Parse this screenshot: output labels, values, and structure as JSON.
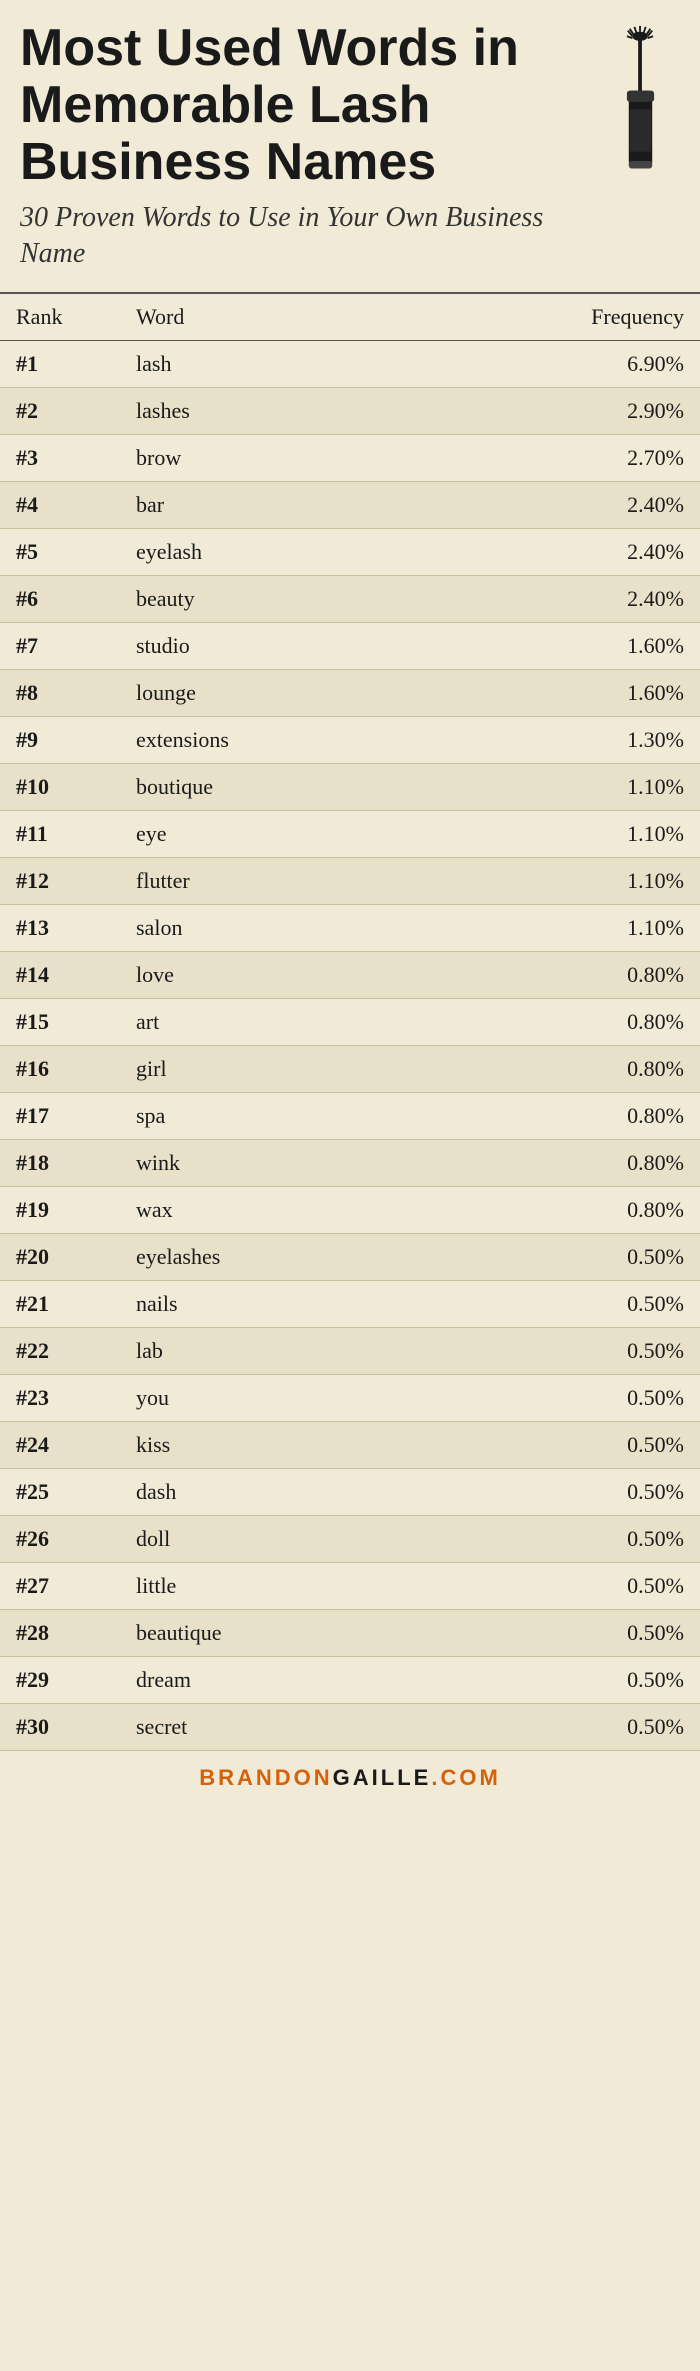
{
  "header": {
    "main_title": "Most Used Words in Memorable Lash Business Names",
    "subtitle": "30 Proven Words to Use in Your Own Business Name"
  },
  "table": {
    "columns": [
      "Rank",
      "Word",
      "Frequency"
    ],
    "rows": [
      {
        "rank": "#1",
        "word": "lash",
        "frequency": "6.90%"
      },
      {
        "rank": "#2",
        "word": "lashes",
        "frequency": "2.90%"
      },
      {
        "rank": "#3",
        "word": "brow",
        "frequency": "2.70%"
      },
      {
        "rank": "#4",
        "word": "bar",
        "frequency": "2.40%"
      },
      {
        "rank": "#5",
        "word": "eyelash",
        "frequency": "2.40%"
      },
      {
        "rank": "#6",
        "word": "beauty",
        "frequency": "2.40%"
      },
      {
        "rank": "#7",
        "word": "studio",
        "frequency": "1.60%"
      },
      {
        "rank": "#8",
        "word": "lounge",
        "frequency": "1.60%"
      },
      {
        "rank": "#9",
        "word": "extensions",
        "frequency": "1.30%"
      },
      {
        "rank": "#10",
        "word": "boutique",
        "frequency": "1.10%"
      },
      {
        "rank": "#11",
        "word": "eye",
        "frequency": "1.10%"
      },
      {
        "rank": "#12",
        "word": "flutter",
        "frequency": "1.10%"
      },
      {
        "rank": "#13",
        "word": "salon",
        "frequency": "1.10%"
      },
      {
        "rank": "#14",
        "word": "love",
        "frequency": "0.80%"
      },
      {
        "rank": "#15",
        "word": "art",
        "frequency": "0.80%"
      },
      {
        "rank": "#16",
        "word": "girl",
        "frequency": "0.80%"
      },
      {
        "rank": "#17",
        "word": "spa",
        "frequency": "0.80%"
      },
      {
        "rank": "#18",
        "word": "wink",
        "frequency": "0.80%"
      },
      {
        "rank": "#19",
        "word": "wax",
        "frequency": "0.80%"
      },
      {
        "rank": "#20",
        "word": "eyelashes",
        "frequency": "0.50%"
      },
      {
        "rank": "#21",
        "word": "nails",
        "frequency": "0.50%"
      },
      {
        "rank": "#22",
        "word": "lab",
        "frequency": "0.50%"
      },
      {
        "rank": "#23",
        "word": "you",
        "frequency": "0.50%"
      },
      {
        "rank": "#24",
        "word": "kiss",
        "frequency": "0.50%"
      },
      {
        "rank": "#25",
        "word": "dash",
        "frequency": "0.50%"
      },
      {
        "rank": "#26",
        "word": "doll",
        "frequency": "0.50%"
      },
      {
        "rank": "#27",
        "word": "little",
        "frequency": "0.50%"
      },
      {
        "rank": "#28",
        "word": "beautique",
        "frequency": "0.50%"
      },
      {
        "rank": "#29",
        "word": "dream",
        "frequency": "0.50%"
      },
      {
        "rank": "#30",
        "word": "secret",
        "frequency": "0.50%"
      }
    ]
  },
  "footer": {
    "brand_part1": "BRANDON",
    "brand_part2": "GAILLE",
    "brand_part3": ".COM"
  }
}
